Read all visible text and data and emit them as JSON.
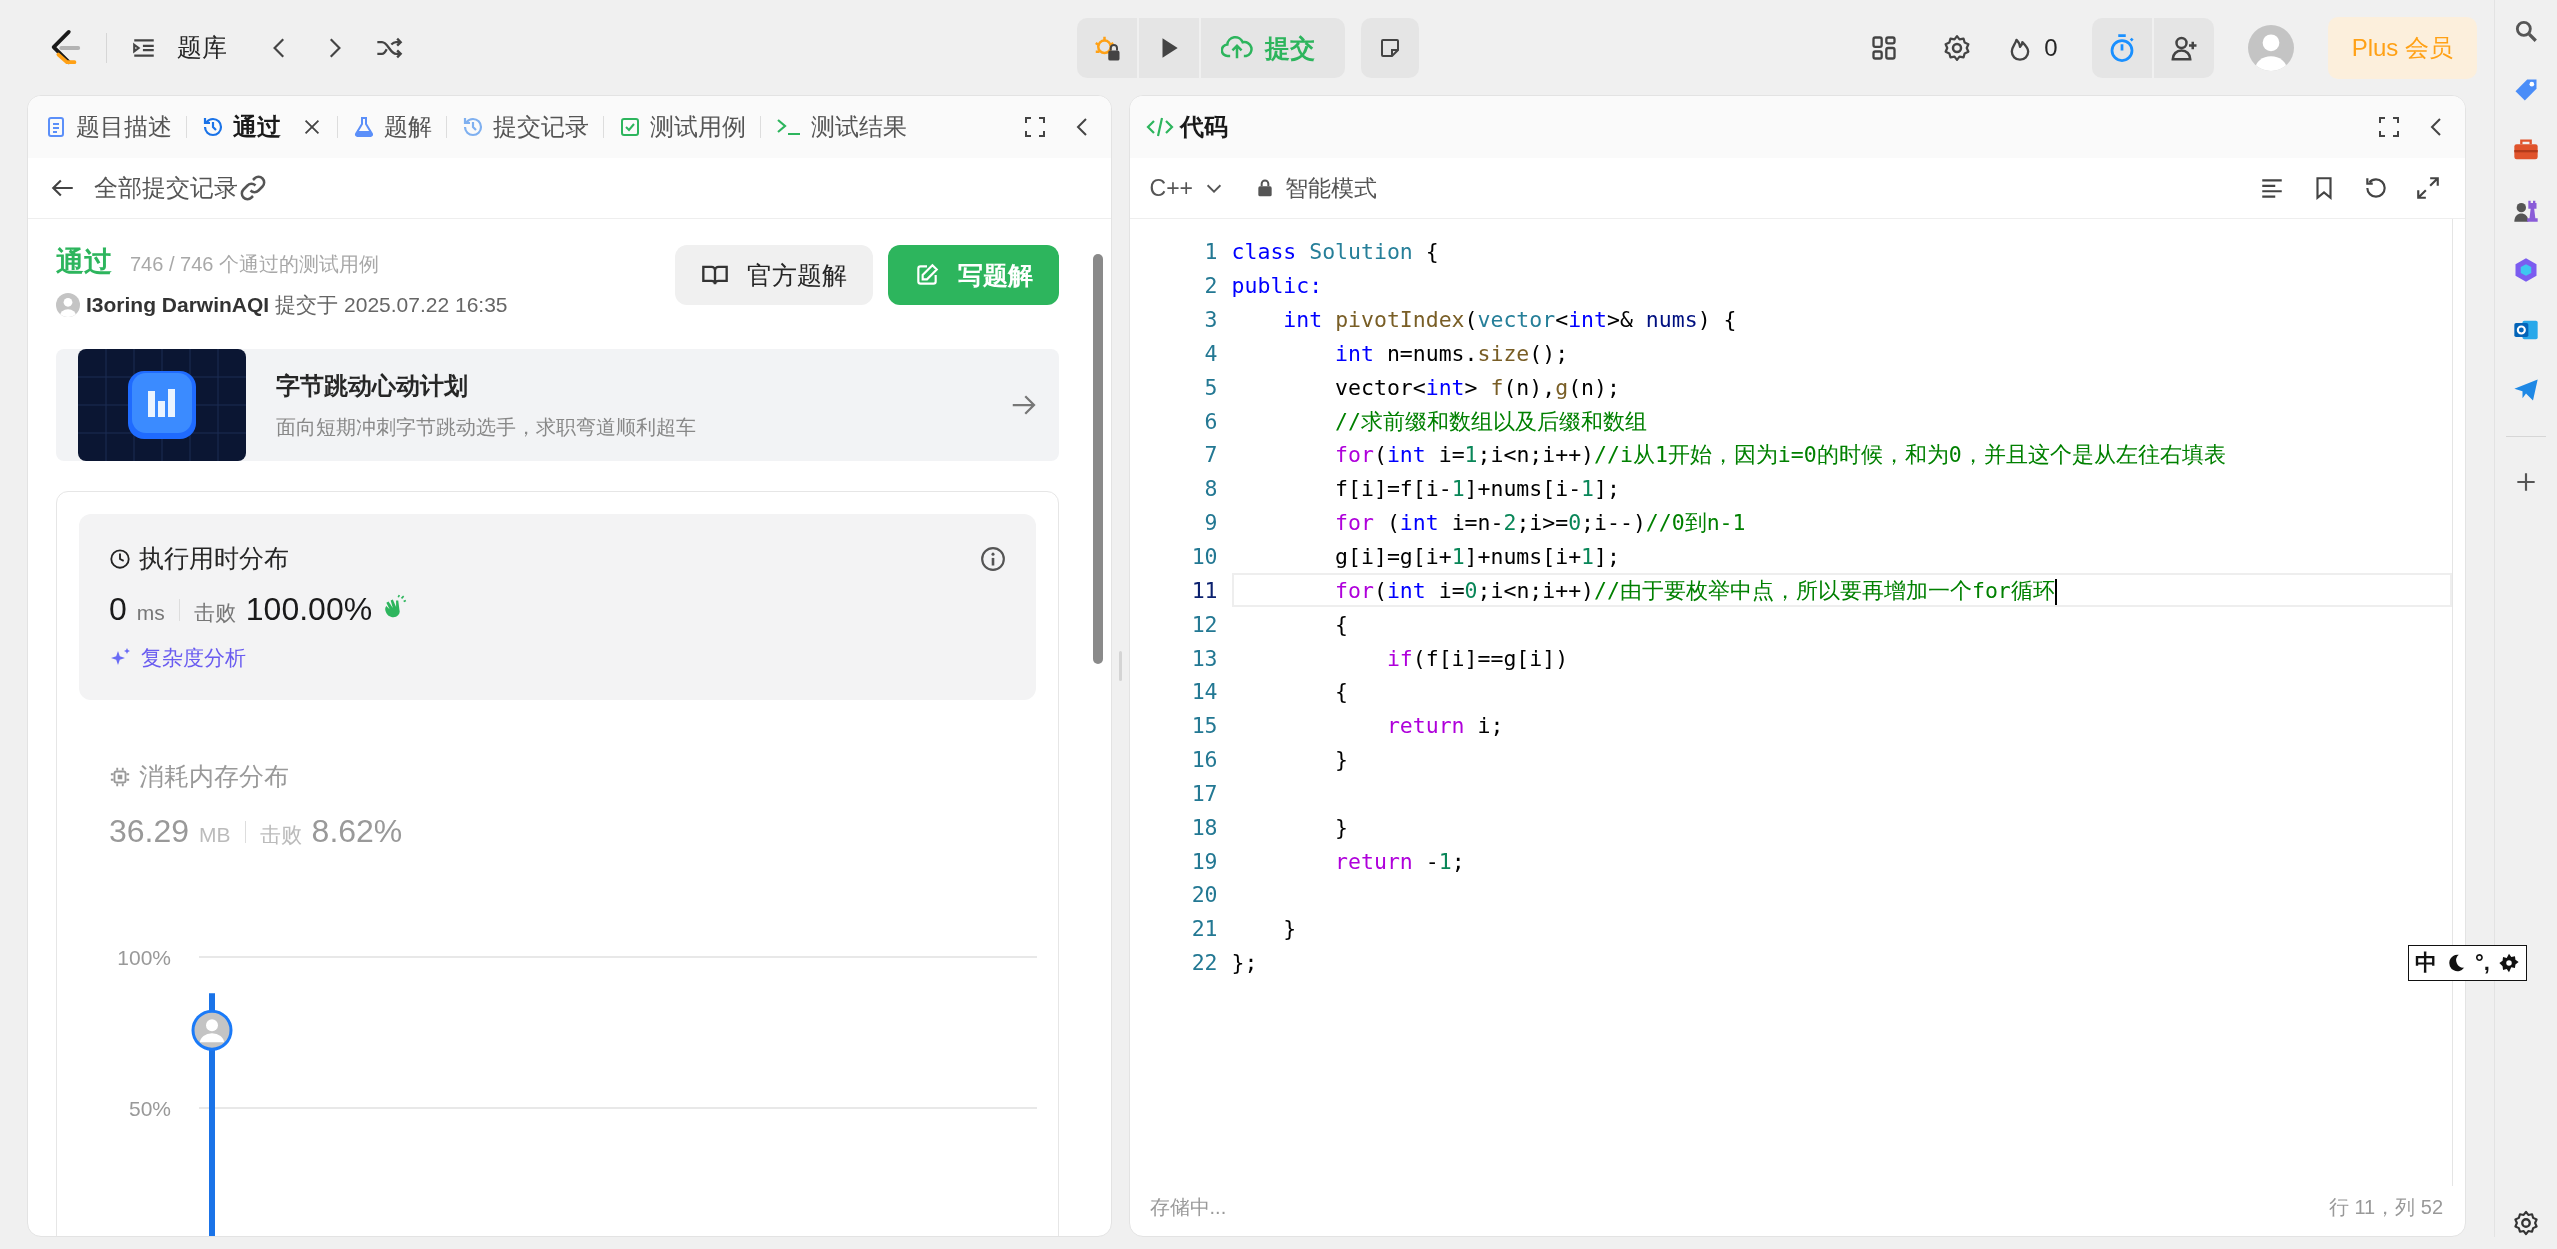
{
  "topbar": {
    "problem_list": "题库",
    "submit": "提交",
    "streak": "0",
    "plus": "Plus 会员"
  },
  "left_panel": {
    "tabs": [
      {
        "label": "题目描述",
        "kind": "description",
        "selected": false,
        "closable": false
      },
      {
        "label": "通过",
        "kind": "history",
        "selected": true,
        "closable": true
      },
      {
        "label": "题解",
        "kind": "flask",
        "selected": false,
        "closable": false
      },
      {
        "label": "提交记录",
        "kind": "history",
        "selected": false,
        "closable": false
      },
      {
        "label": "测试用例",
        "kind": "check",
        "selected": false,
        "closable": false
      },
      {
        "label": "测试结果",
        "kind": "terminal",
        "selected": false,
        "closable": false
      }
    ],
    "back_link": "全部提交记录",
    "result": {
      "status": "通过",
      "passed": "746 / 746 个通过的测试用例",
      "author": "I3oring DarwinAQI",
      "submitted": "提交于 2025.07.22 16:35"
    },
    "buttons": [
      {
        "label": "官方题解",
        "kind": "secondary"
      },
      {
        "label": "写题解",
        "kind": "primary"
      }
    ],
    "banner": {
      "title": "字节跳动心动计划",
      "subtitle": "面向短期冲刺字节跳动选手，求职弯道顺利超车"
    },
    "runtime": {
      "title": "执行用时分布",
      "value": "0",
      "unit": "ms",
      "beats_label": "击败",
      "beats": "100.00%",
      "analysis": "复杂度分析"
    },
    "memory": {
      "title": "消耗内存分布",
      "value": "36.29",
      "unit": "MB",
      "beats_label": "击败",
      "beats": "8.62%",
      "chart_data": {
        "type": "bar",
        "categories": [
          null
        ],
        "values": [
          88
        ],
        "ylim": [
          0,
          100
        ],
        "yticks": [
          {
            "value": 50,
            "label": "50%"
          },
          {
            "value": 100,
            "label": "100%"
          }
        ]
      }
    }
  },
  "code_panel": {
    "title": "代码",
    "language": "C++",
    "mode": "智能模式",
    "status": "存储中...",
    "cursor": "行 11，列 52",
    "lines": [
      {
        "number": "1",
        "current": false,
        "tokens": [
          {
            "text": "class ",
            "kind": "kw"
          },
          {
            "text": "Solution",
            "kind": "type"
          },
          {
            "text": " {",
            "kind": "plain"
          }
        ]
      },
      {
        "number": "2",
        "current": false,
        "tokens": [
          {
            "text": "public:",
            "kind": "kw"
          }
        ]
      },
      {
        "number": "3",
        "current": false,
        "tokens": [
          {
            "text": "    int ",
            "kind": "kw"
          },
          {
            "text": "pivotIndex",
            "kind": "fn"
          },
          {
            "text": "(",
            "kind": "plain"
          },
          {
            "text": "vector",
            "kind": "type"
          },
          {
            "text": "<",
            "kind": "plain"
          },
          {
            "text": "int",
            "kind": "kw"
          },
          {
            "text": ">& ",
            "kind": "plain"
          },
          {
            "text": "nums",
            "kind": "var"
          },
          {
            "text": ") {",
            "kind": "plain"
          }
        ]
      },
      {
        "number": "4",
        "current": false,
        "tokens": [
          {
            "text": "        int",
            "kind": "kw"
          },
          {
            "text": " n=nums.",
            "kind": "plain"
          },
          {
            "text": "size",
            "kind": "fn"
          },
          {
            "text": "();",
            "kind": "plain"
          }
        ]
      },
      {
        "number": "5",
        "current": false,
        "tokens": [
          {
            "text": "        vector<",
            "kind": "plain"
          },
          {
            "text": "int",
            "kind": "kw"
          },
          {
            "text": "> ",
            "kind": "plain"
          },
          {
            "text": "f",
            "kind": "fn"
          },
          {
            "text": "(n),",
            "kind": "plain"
          },
          {
            "text": "g",
            "kind": "fn"
          },
          {
            "text": "(n);",
            "kind": "plain"
          }
        ]
      },
      {
        "number": "6",
        "current": false,
        "tokens": [
          {
            "text": "        //求前缀和数组以及后缀和数组",
            "kind": "cmt"
          }
        ]
      },
      {
        "number": "7",
        "current": false,
        "tokens": [
          {
            "text": "        for",
            "kind": "ctrl"
          },
          {
            "text": "(",
            "kind": "plain"
          },
          {
            "text": "int",
            "kind": "kw"
          },
          {
            "text": " i=",
            "kind": "plain"
          },
          {
            "text": "1",
            "kind": "num"
          },
          {
            "text": ";i<n;i++)",
            "kind": "plain"
          },
          {
            "text": "//i从1开始，因为i=0的时候，和为0，并且这个是从左往右填表",
            "kind": "cmt"
          }
        ]
      },
      {
        "number": "8",
        "current": false,
        "tokens": [
          {
            "text": "        f[i]=f[i-",
            "kind": "plain"
          },
          {
            "text": "1",
            "kind": "num"
          },
          {
            "text": "]+nums[i-",
            "kind": "plain"
          },
          {
            "text": "1",
            "kind": "num"
          },
          {
            "text": "];",
            "kind": "plain"
          }
        ]
      },
      {
        "number": "9",
        "current": false,
        "tokens": [
          {
            "text": "        for",
            "kind": "ctrl"
          },
          {
            "text": " (",
            "kind": "plain"
          },
          {
            "text": "int",
            "kind": "kw"
          },
          {
            "text": " i=n-",
            "kind": "plain"
          },
          {
            "text": "2",
            "kind": "num"
          },
          {
            "text": ";i>=",
            "kind": "plain"
          },
          {
            "text": "0",
            "kind": "num"
          },
          {
            "text": ";i--)",
            "kind": "plain"
          },
          {
            "text": "//0到n-1",
            "kind": "cmt"
          }
        ]
      },
      {
        "number": "10",
        "current": false,
        "tokens": [
          {
            "text": "        g[i]=g[i+",
            "kind": "plain"
          },
          {
            "text": "1",
            "kind": "num"
          },
          {
            "text": "]+nums[i+",
            "kind": "plain"
          },
          {
            "text": "1",
            "kind": "num"
          },
          {
            "text": "];",
            "kind": "plain"
          }
        ]
      },
      {
        "number": "11",
        "current": true,
        "tokens": [
          {
            "text": "        for",
            "kind": "ctrl"
          },
          {
            "text": "(",
            "kind": "plain"
          },
          {
            "text": "int",
            "kind": "kw"
          },
          {
            "text": " i=",
            "kind": "plain"
          },
          {
            "text": "0",
            "kind": "num"
          },
          {
            "text": ";i<n;i++)",
            "kind": "plain"
          },
          {
            "text": "//由于要枚举中点，所以要再增加一个for循环",
            "kind": "cmt"
          }
        ]
      },
      {
        "number": "12",
        "current": false,
        "tokens": [
          {
            "text": "        {",
            "kind": "plain"
          }
        ]
      },
      {
        "number": "13",
        "current": false,
        "tokens": [
          {
            "text": "            if",
            "kind": "ctrl"
          },
          {
            "text": "(f[i]==g[i])",
            "kind": "plain"
          }
        ]
      },
      {
        "number": "14",
        "current": false,
        "tokens": [
          {
            "text": "        {",
            "kind": "plain"
          }
        ]
      },
      {
        "number": "15",
        "current": false,
        "tokens": [
          {
            "text": "            return",
            "kind": "ctrl"
          },
          {
            "text": " i;",
            "kind": "plain"
          }
        ]
      },
      {
        "number": "16",
        "current": false,
        "tokens": [
          {
            "text": "        }",
            "kind": "plain"
          }
        ]
      },
      {
        "number": "17",
        "current": false
      },
      {
        "number": "18",
        "current": false,
        "tokens": [
          {
            "text": "        }",
            "kind": "plain"
          }
        ]
      },
      {
        "number": "19",
        "current": false,
        "tokens": [
          {
            "text": "        return",
            "kind": "ctrl"
          },
          {
            "text": " -",
            "kind": "plain"
          },
          {
            "text": "1",
            "kind": "num"
          },
          {
            "text": ";",
            "kind": "plain"
          }
        ]
      },
      {
        "number": "20",
        "current": false
      },
      {
        "number": "21",
        "current": false,
        "tokens": [
          {
            "text": "    }",
            "kind": "plain"
          }
        ]
      },
      {
        "number": "22",
        "current": false,
        "tokens": [
          {
            "text": "};",
            "kind": "plain"
          }
        ]
      }
    ]
  },
  "ime_toolbar": {
    "mode": "中",
    "punct": "°,"
  }
}
